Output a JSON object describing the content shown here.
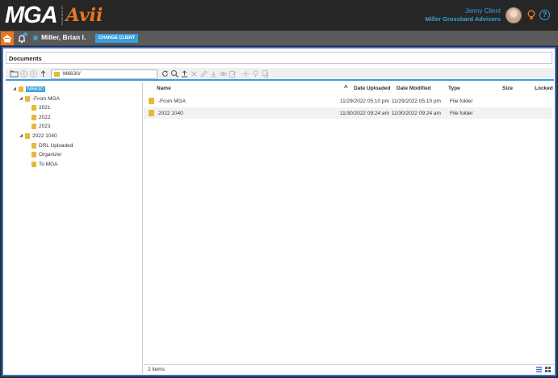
{
  "brand": {
    "logo_text": "MGA",
    "powered_text": "POWERED BY",
    "sub_logo_text": "Avii",
    "accent": "#e87722",
    "link_color": "#3aa0dc"
  },
  "user": {
    "name": "Jenny Client",
    "org": "Miller Grossbard Advisors"
  },
  "icons": {
    "home": "home-icon",
    "bell": "bell-icon",
    "bulb": "lightbulb-icon",
    "help": "help-icon"
  },
  "client": {
    "name": "Miller, Brian I.",
    "change_label": "CHANGE CLIENT"
  },
  "documents": {
    "title": "Documents",
    "path": "M6630/",
    "toolbar": [
      "new-folder-icon",
      "back-icon",
      "forward-icon",
      "up-icon",
      "refresh-icon",
      "search-icon",
      "upload-icon",
      "delete-icon",
      "rename-icon",
      "download-icon",
      "view-icon",
      "edit-icon",
      "move-icon",
      "tag-icon",
      "note-icon"
    ]
  },
  "tree": [
    {
      "label": "M6630",
      "selected": true
    },
    {
      "label": "-From MGA"
    },
    {
      "label": "2021"
    },
    {
      "label": "2022"
    },
    {
      "label": "2023"
    },
    {
      "label": "2022 1040"
    },
    {
      "label": "DRL Uploaded"
    },
    {
      "label": "Organizer"
    },
    {
      "label": "To MGA"
    }
  ],
  "columns": {
    "name": "Name",
    "uploaded": "Date Uploaded",
    "modified": "Date Modified",
    "type": "Type",
    "size": "Size",
    "locked": "Locked"
  },
  "rows": [
    {
      "name": "-From MGA",
      "uploaded": "11/29/2022 05:10 pm",
      "modified": "11/29/2022 05:10 pm",
      "type": "File folder",
      "size": "",
      "locked": ""
    },
    {
      "name": "2022 1040",
      "uploaded": "11/30/2022 09:24 am",
      "modified": "11/30/2022 09:24 am",
      "type": "File folder",
      "size": "",
      "locked": ""
    }
  ],
  "status": {
    "count": "2 items"
  }
}
